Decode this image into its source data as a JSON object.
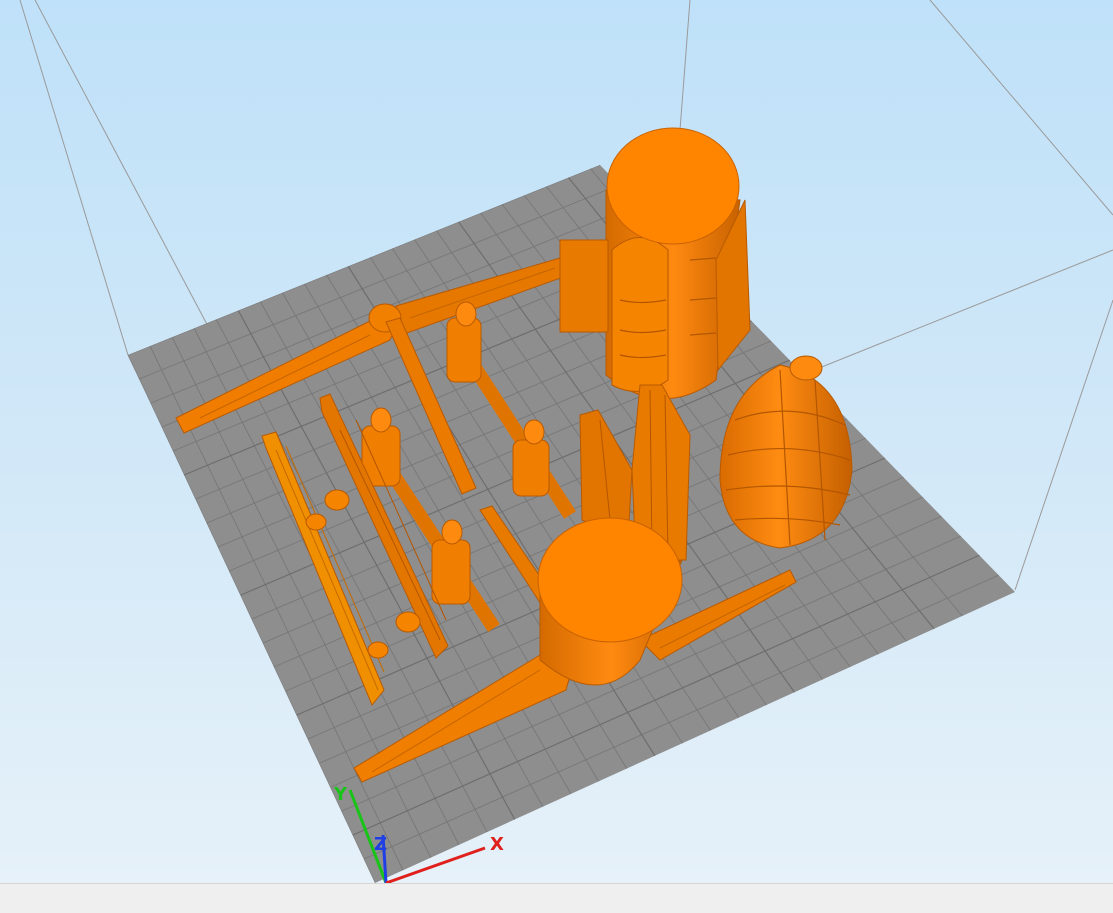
{
  "app": {
    "view": "3d-print-preview"
  },
  "colors": {
    "background_top": "#bfe1f9",
    "build_plate": "#8e8e8e",
    "grid_line": "#777777",
    "model": "#ff8400",
    "model_shade": "#d96f00",
    "axis_x": "#e0201c",
    "axis_y": "#19c419",
    "axis_z": "#1f3fe6"
  },
  "axes": {
    "x_label": "X",
    "y_label": "Y",
    "z_label": "Z"
  },
  "icons": [
    "axis-gizmo"
  ]
}
